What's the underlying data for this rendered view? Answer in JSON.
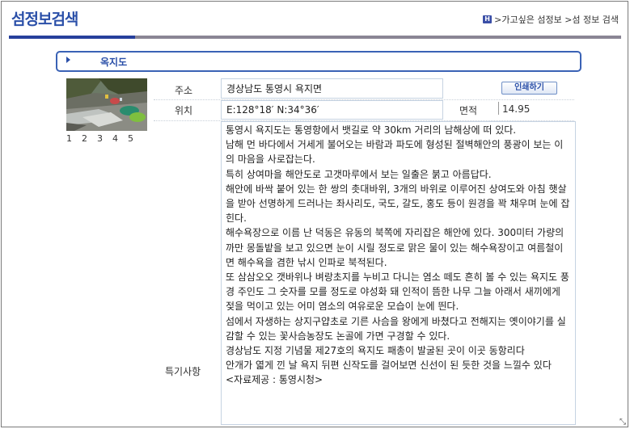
{
  "page": {
    "title": "섬정보검색",
    "breadcrumb": {
      "home_icon": "H",
      "path": ">가고싶은 섬정보 >섬 정보 검색"
    }
  },
  "island": {
    "name": "옥지도",
    "print_button": "인쇄하기",
    "address_label": "주소",
    "address": "경상남도 통영시 욕지면",
    "location_label": "위치",
    "location": "E:128°18′ N:34°36′",
    "area_label": "면적",
    "area": "14.95",
    "notes_label": "특기사항",
    "photo_pages": [
      "1",
      "2",
      "3",
      "4",
      "5"
    ],
    "description": [
      "통영시 욕지도는 통영항에서 뱃길로 약 30km 거리의 남해상에 떠 있다.",
      "남해 먼 바다에서 거세게 불어오는 바람과 파도에 형성된 절벽해안의 풍광이 보는 이의 마음을 사로잡는다.",
      "특히 상여마을 해안도로 고갯마루에서 보는 일출은 붉고 아름답다.",
      "해안에 바싹 붙어 있는 한 쌍의 촛대바위, 3개의 바위로 이루어진 상여도와 아침 햇살을 받아 선명하게 드러나는 좌사리도, 국도, 갈도, 홍도 등이 원경을 꽉 채우며 눈에 잡힌다.",
      "해수욕장으로 이름 난 덕동은 유동의 북쪽에 자리잡은 해안에 있다. 300미터 가량의 까만 몽돌밭을 보고 있으면 눈이 시릴 정도로 맑은 물이 있는 해수욕장이고 여름철이면 해수욕을 겸한 낚시 인파로 북적된다.",
      "또 삼삼오오 갯바위나 벼랑초지를 누비고 다니는 염소 떼도 흔히 볼 수 있는 욕지도 풍경 주인도 그 숫자를 모를 정도로 야성화 돼 인적이 뜸한 나무 그늘 아래서 새끼에게 젖을 먹이고 있는 어미 염소의 여유로운 모습이 눈에 띈다.",
      "섬에서 자생하는 상지구얍초로 기른 사슴을 왕에게 바쳤다고 전해지는 옛이야기를 실감할 수 있는 꽃사슴농장도 논골에 가면 구경할 수 있다.",
      "경상남도 지정 기념물 제27호의 욕지도 패총이 발굴된 곳이 이곳 동항리다",
      "안개가 엷게 낀 날 욕지 뒤편 신작도를 걸어보면 신선이 된 듯한 것을 느낄수 있다",
      "<자료제공 : 통영시청>"
    ]
  },
  "colors": {
    "title": "#2a4fa8",
    "rule_blue": "#263f9c",
    "rule_gray": "#8a8594",
    "name_border": "#3a62b5"
  }
}
